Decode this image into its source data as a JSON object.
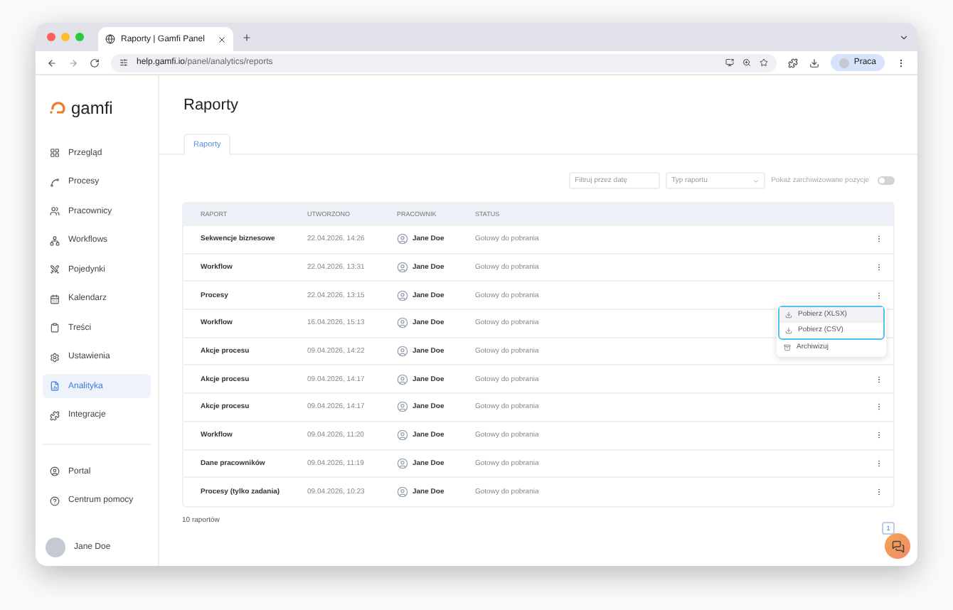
{
  "browser": {
    "tab_title": "Raporty | Gamfi Panel",
    "url_host": "help.gamfi.io",
    "url_path": "/panel/analytics/reports",
    "profile": "Praca"
  },
  "sidebar": {
    "logo": "gamfi",
    "items": [
      {
        "label": "Przegląd",
        "selected": false
      },
      {
        "label": "Procesy",
        "selected": false
      },
      {
        "label": "Pracownicy",
        "selected": false
      },
      {
        "label": "Workflows",
        "selected": false
      },
      {
        "label": "Pojedynki",
        "selected": false
      },
      {
        "label": "Kalendarz",
        "selected": false
      },
      {
        "label": "Treści",
        "selected": false
      },
      {
        "label": "Ustawienia",
        "selected": false
      },
      {
        "label": "Analityka",
        "selected": true
      },
      {
        "label": "Integracje",
        "selected": false
      }
    ],
    "footer_items": [
      {
        "label": "Portal"
      },
      {
        "label": "Centrum pomocy"
      }
    ],
    "user": "Jane Doe"
  },
  "page": {
    "title": "Raporty",
    "tabs": [
      {
        "label": "Raporty",
        "selected": true
      }
    ]
  },
  "filters": {
    "date_placeholder": "Filtruj przez datę",
    "type_placeholder": "Typ raportu",
    "archived_label": "Pokaż zarchiwizowane pozycje",
    "archived_on": false
  },
  "table": {
    "columns": [
      "RAPORT",
      "UTWORZONO",
      "PRACOWNIK",
      "STATUS"
    ],
    "rows": [
      {
        "report": "Sekwencje biznesowe",
        "created": "22.04.2026, 14:26",
        "employee": "Jane Doe",
        "status": "Gotowy do pobrania",
        "menu_open": false
      },
      {
        "report": "Workflow",
        "created": "22.04.2026, 13:31",
        "employee": "Jane Doe",
        "status": "Gotowy do pobrania",
        "menu_open": false
      },
      {
        "report": "Procesy",
        "created": "22.04.2026, 13:15",
        "employee": "Jane Doe",
        "status": "Gotowy do pobrania",
        "menu_open": true
      },
      {
        "report": "Workflow",
        "created": "16.04.2026, 15:13",
        "employee": "Jane Doe",
        "status": "Gotowy do pobrania",
        "menu_open": false
      },
      {
        "report": "Akcje procesu",
        "created": "09.04.2026, 14:22",
        "employee": "Jane Doe",
        "status": "Gotowy do pobrania",
        "menu_open": false
      },
      {
        "report": "Akcje procesu",
        "created": "09.04.2026, 14:17",
        "employee": "Jane Doe",
        "status": "Gotowy do pobrania",
        "menu_open": false
      },
      {
        "report": "Akcje procesu",
        "created": "09.04.2026, 14:17",
        "employee": "Jane Doe",
        "status": "Gotowy do pobrania",
        "menu_open": false
      },
      {
        "report": "Workflow",
        "created": "09.04.2026, 11:20",
        "employee": "Jane Doe",
        "status": "Gotowy do pobrania",
        "menu_open": false
      },
      {
        "report": "Dane pracowników",
        "created": "09.04.2026, 11:19",
        "employee": "Jane Doe",
        "status": "Gotowy do pobrania",
        "menu_open": false
      },
      {
        "report": "Procesy (tylko zadania)",
        "created": "09.04.2026, 10:23",
        "employee": "Jane Doe",
        "status": "Gotowy do pobrania",
        "menu_open": false
      }
    ]
  },
  "row_menu": {
    "items": [
      {
        "label": "Pobierz (XLSX)",
        "kind": "download",
        "selected": true,
        "focused": true
      },
      {
        "label": "Pobierz (CSV)",
        "kind": "download",
        "selected": false,
        "focused": true
      },
      {
        "label": "Archiwizuj",
        "kind": "archive",
        "selected": false,
        "focused": false
      }
    ]
  },
  "count": "10 raportów",
  "pagination": [
    {
      "label": "1",
      "selected": true
    }
  ]
}
